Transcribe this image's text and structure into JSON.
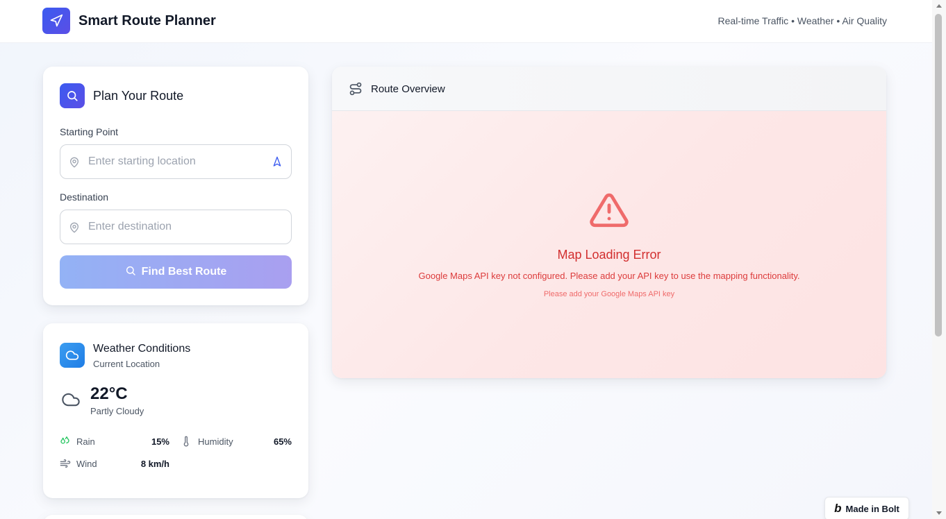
{
  "header": {
    "app_title": "Smart Route Planner",
    "tagline": "Real-time Traffic • Weather • Air Quality"
  },
  "plan": {
    "title": "Plan Your Route",
    "start_label": "Starting Point",
    "start_placeholder": "Enter starting location",
    "start_value": "",
    "dest_label": "Destination",
    "dest_placeholder": "Enter destination",
    "dest_value": "",
    "find_button": "Find Best Route"
  },
  "weather": {
    "title": "Weather Conditions",
    "subtitle": "Current Location",
    "temperature": "22°C",
    "condition": "Partly Cloudy",
    "stats": {
      "rain_label": "Rain",
      "rain_value": "15%",
      "humidity_label": "Humidity",
      "humidity_value": "65%",
      "wind_label": "Wind",
      "wind_value": "8 km/h"
    }
  },
  "map": {
    "title": "Route Overview",
    "error_title": "Map Loading Error",
    "error_message": "Google Maps API key not configured. Please add your API key to use the mapping functionality.",
    "error_hint": "Please add your Google Maps API key"
  },
  "badge": {
    "label": "Made in Bolt"
  },
  "colors": {
    "brand": "#3b5bf0",
    "error": "#d22f2f",
    "rain_icon": "#22c55e"
  },
  "icons": {
    "logo": "navigation-arrow-icon",
    "plan": "search-icon",
    "weather": "cloud-icon",
    "map": "route-icon",
    "error": "warning-triangle-icon"
  }
}
